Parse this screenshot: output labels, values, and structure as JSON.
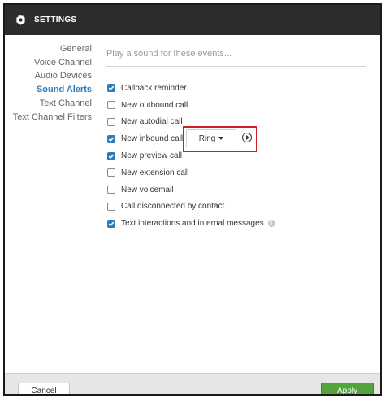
{
  "header": {
    "title": "SETTINGS",
    "icon": "gear-icon"
  },
  "sidebar": {
    "items": [
      {
        "label": "General",
        "active": false
      },
      {
        "label": "Voice Channel",
        "active": false
      },
      {
        "label": "Audio Devices",
        "active": false
      },
      {
        "label": "Sound Alerts",
        "active": true
      },
      {
        "label": "Text Channel",
        "active": false
      },
      {
        "label": "Text Channel Filters",
        "active": false
      }
    ]
  },
  "main": {
    "hint": "Play a sound for these events...",
    "events": [
      {
        "label": "Callback reminder",
        "checked": true
      },
      {
        "label": "New outbound call",
        "checked": false
      },
      {
        "label": "New autodial call",
        "checked": false
      },
      {
        "label": "New inbound call",
        "checked": true
      },
      {
        "label": "New preview call",
        "checked": true
      },
      {
        "label": "New extension call",
        "checked": false
      },
      {
        "label": "New voicemail",
        "checked": false
      },
      {
        "label": "Call disconnected by contact",
        "checked": false
      },
      {
        "label": "Text interactions and internal messages",
        "checked": true
      }
    ],
    "sound_dropdown": {
      "selected": "Ring"
    }
  },
  "footer": {
    "cancel_label": "Cancel",
    "apply_label": "Apply"
  },
  "colors": {
    "header_bg": "#2d2d2d",
    "accent": "#2e7dba",
    "apply_green": "#54a33f",
    "highlight_red": "#cc1f2a"
  }
}
